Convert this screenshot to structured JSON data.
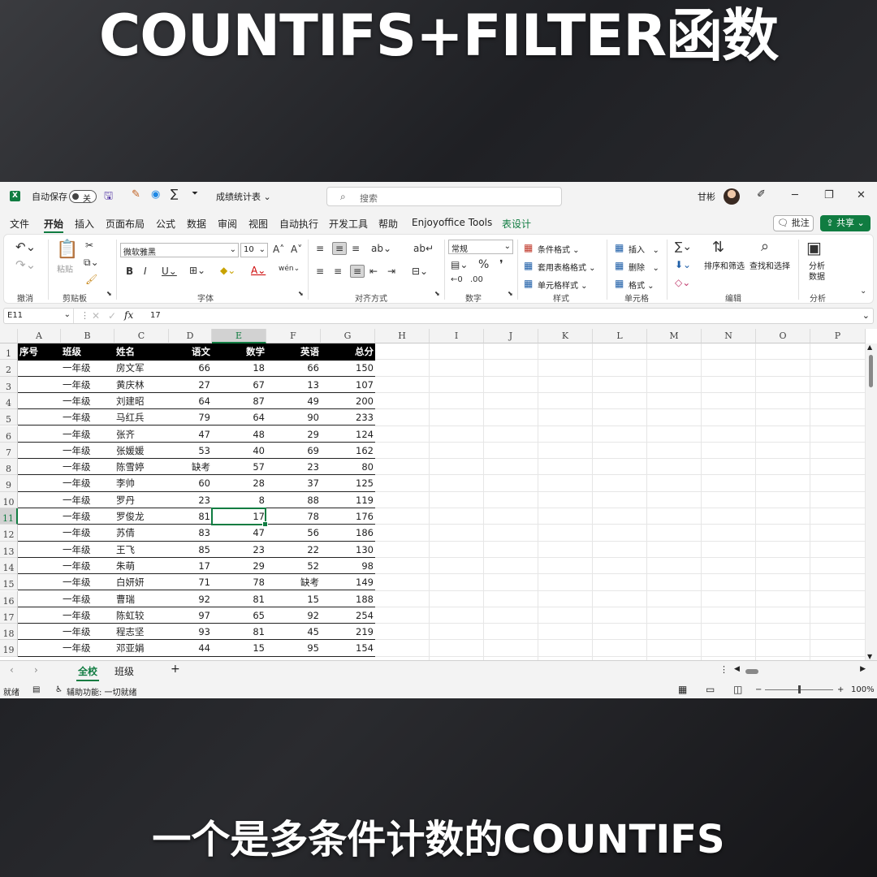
{
  "video": {
    "title": "COUNTIFS+FILTER函数",
    "caption": "一个是多条件计数的COUNTIFS"
  },
  "titlebar": {
    "app_icon": "X",
    "autosave_label": "自动保存",
    "autosave_state": "关",
    "file_name": "成绩统计表",
    "search_placeholder": "搜索",
    "user_name": "甘彬"
  },
  "menu": {
    "tabs": [
      "文件",
      "开始",
      "插入",
      "页面布局",
      "公式",
      "数据",
      "审阅",
      "视图",
      "自动执行",
      "开发工具",
      "帮助",
      "Enjoyoffice Tools",
      "表设计"
    ],
    "active_tab": "开始",
    "comment_label": "批注",
    "share_label": "共享"
  },
  "ribbon": {
    "groups": {
      "undo": "撤消",
      "clipboard": "剪贴板",
      "font": "字体",
      "alignment": "对齐方式",
      "number": "数字",
      "styles": "样式",
      "cells": "单元格",
      "editing": "编辑",
      "analysis": "分析"
    },
    "paste_label": "粘贴",
    "font_name": "微软雅黑",
    "font_size": "10",
    "number_format": "常规",
    "conditional_format": "条件格式",
    "table_format": "套用表格格式",
    "cell_style": "单元格样式",
    "insert": "插入",
    "delete": "删除",
    "format": "格式",
    "sort_filter": "排序和筛选",
    "find_select": "查找和选择",
    "analyze_line1": "分析",
    "analyze_line2": "数据"
  },
  "formula_bar": {
    "name_box": "E11",
    "fx": "fx",
    "value": "17"
  },
  "grid": {
    "columns": [
      "A",
      "B",
      "C",
      "D",
      "E",
      "F",
      "G",
      "H",
      "I",
      "J",
      "K",
      "L",
      "M",
      "N",
      "O",
      "P"
    ],
    "row_numbers": [
      "1",
      "2",
      "3",
      "4",
      "5",
      "6",
      "7",
      "8",
      "9",
      "10",
      "11",
      "12",
      "13",
      "14",
      "15",
      "16",
      "17",
      "18",
      "19"
    ],
    "headers": [
      "序号",
      "班级",
      "姓名",
      "语文",
      "数学",
      "英语",
      "总分"
    ],
    "rows": [
      [
        "",
        "一年级",
        "房文军",
        "66",
        "18",
        "66",
        "150"
      ],
      [
        "",
        "一年级",
        "黄庆林",
        "27",
        "67",
        "13",
        "107"
      ],
      [
        "",
        "一年级",
        "刘建昭",
        "64",
        "87",
        "49",
        "200"
      ],
      [
        "",
        "一年级",
        "马红兵",
        "79",
        "64",
        "90",
        "233"
      ],
      [
        "",
        "一年级",
        "张齐",
        "47",
        "48",
        "29",
        "124"
      ],
      [
        "",
        "一年级",
        "张媛媛",
        "53",
        "40",
        "69",
        "162"
      ],
      [
        "",
        "一年级",
        "陈雪婷",
        "缺考",
        "57",
        "23",
        "80"
      ],
      [
        "",
        "一年级",
        "李帅",
        "60",
        "28",
        "37",
        "125"
      ],
      [
        "",
        "一年级",
        "罗丹",
        "23",
        "8",
        "88",
        "119"
      ],
      [
        "",
        "一年级",
        "罗俊龙",
        "81",
        "17",
        "78",
        "176"
      ],
      [
        "",
        "一年级",
        "苏倩",
        "83",
        "47",
        "56",
        "186"
      ],
      [
        "",
        "一年级",
        "王飞",
        "85",
        "23",
        "22",
        "130"
      ],
      [
        "",
        "一年级",
        "朱萌",
        "17",
        "29",
        "52",
        "98"
      ],
      [
        "",
        "一年级",
        "白妍妍",
        "71",
        "78",
        "缺考",
        "149"
      ],
      [
        "",
        "一年级",
        "曹瑞",
        "92",
        "81",
        "15",
        "188"
      ],
      [
        "",
        "一年级",
        "陈虹较",
        "97",
        "65",
        "92",
        "254"
      ],
      [
        "",
        "一年级",
        "程志坚",
        "93",
        "81",
        "45",
        "219"
      ],
      [
        "",
        "一年级",
        "邓亚娟",
        "44",
        "15",
        "95",
        "154"
      ]
    ]
  },
  "sheets": {
    "tabs": [
      "全校",
      "班级"
    ],
    "active": "全校",
    "add_label": "+"
  },
  "status": {
    "ready": "就绪",
    "accessibility": "辅助功能: 一切就绪",
    "zoom": "100%"
  }
}
